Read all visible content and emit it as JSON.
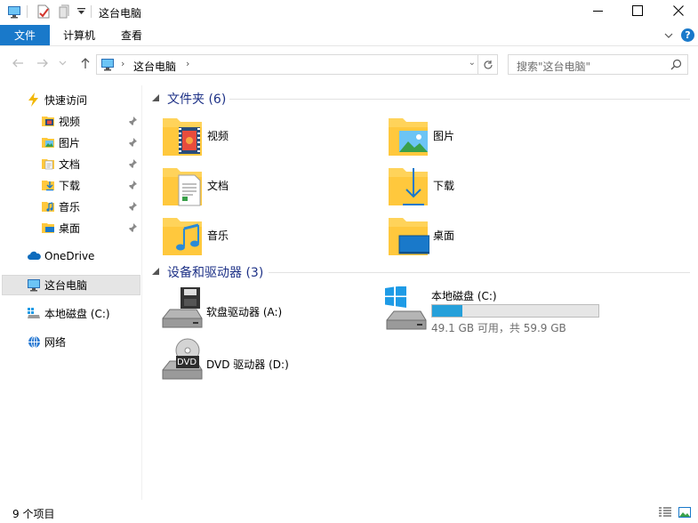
{
  "window": {
    "title": "这台电脑",
    "colors": {
      "accent": "#1979ca",
      "group_header": "#1e3287",
      "bar_fill": "#26a0da",
      "selection": "#e5e5e5"
    }
  },
  "ribbon": {
    "tabs": [
      {
        "label": "文件",
        "active": true
      },
      {
        "label": "计算机"
      },
      {
        "label": "查看"
      }
    ],
    "help": "?"
  },
  "address": {
    "path": [
      "这台电脑"
    ],
    "search_placeholder": "搜索\"这台电脑\""
  },
  "nav": {
    "quick_access": "快速访问",
    "pinned": [
      {
        "label": "视频",
        "icon": "video-folder-icon"
      },
      {
        "label": "图片",
        "icon": "pictures-folder-icon"
      },
      {
        "label": "文档",
        "icon": "documents-folder-icon"
      },
      {
        "label": "下载",
        "icon": "downloads-folder-icon"
      },
      {
        "label": "音乐",
        "icon": "music-folder-icon"
      },
      {
        "label": "桌面",
        "icon": "desktop-folder-icon"
      }
    ],
    "onedrive": "OneDrive",
    "this_pc": "这台电脑",
    "local_disk": "本地磁盘 (C:)",
    "network": "网络"
  },
  "content": {
    "folders_header": "文件夹 (6)",
    "folders": [
      {
        "label": "视频",
        "icon": "video-folder-icon"
      },
      {
        "label": "图片",
        "icon": "pictures-folder-icon"
      },
      {
        "label": "文档",
        "icon": "documents-folder-icon"
      },
      {
        "label": "下载",
        "icon": "downloads-folder-icon"
      },
      {
        "label": "音乐",
        "icon": "music-folder-icon"
      },
      {
        "label": "桌面",
        "icon": "desktop-folder-icon"
      }
    ],
    "devices_header": "设备和驱动器 (3)",
    "floppy": "软盘驱动器 (A:)",
    "local_disk": {
      "name": "本地磁盘 (C:)",
      "free": "49.1 GB 可用，共 59.9 GB",
      "used_fraction": 0.18
    },
    "dvd": "DVD 驱动器 (D:)",
    "dvd_badge": "DVD"
  },
  "status": {
    "item_count": "9 个项目"
  }
}
